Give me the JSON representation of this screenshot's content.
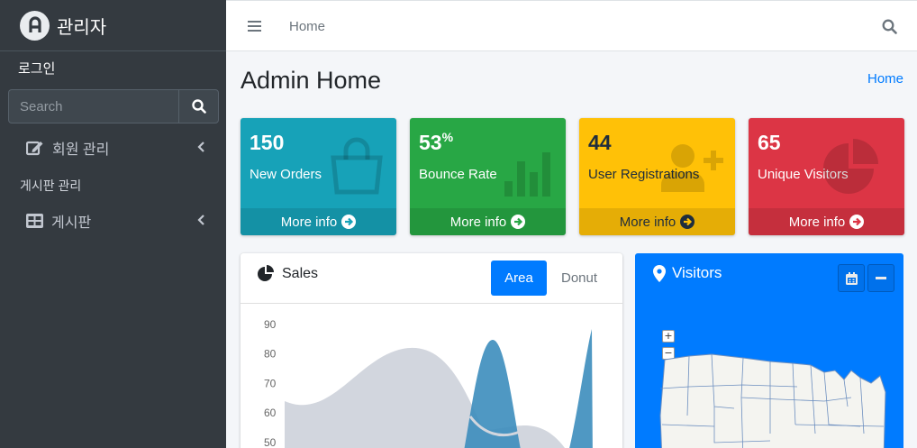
{
  "sidebar": {
    "brand_text": "관리자",
    "user_label": "로그인",
    "search": {
      "placeholder": "Search"
    },
    "items": [
      {
        "label": "회원 관리"
      },
      {
        "header": "게시판 관리"
      },
      {
        "label": "게시판"
      }
    ]
  },
  "navbar": {
    "home_link": "Home"
  },
  "content": {
    "title": "Admin Home",
    "breadcrumb": "Home"
  },
  "boxes": [
    {
      "value": "150",
      "suffix": "",
      "label": "New Orders",
      "footer": "More info",
      "color": "#17a2b8",
      "icon": "shopping-bag-icon"
    },
    {
      "value": "53",
      "suffix": "%",
      "label": "Bounce Rate",
      "footer": "More info",
      "color": "#28a745",
      "icon": "bar-chart-icon"
    },
    {
      "value": "44",
      "suffix": "",
      "label": "User Registrations",
      "footer": "More info",
      "color": "#ffc107",
      "icon": "user-plus-icon"
    },
    {
      "value": "65",
      "suffix": "",
      "label": "Unique Visitors",
      "footer": "More info",
      "color": "#dc3545",
      "icon": "pie-chart-icon"
    }
  ],
  "sales": {
    "title": "Sales",
    "tabs": [
      {
        "label": "Area",
        "active": true
      },
      {
        "label": "Donut",
        "active": false
      }
    ]
  },
  "visitors": {
    "title": "Visitors"
  },
  "chart_data": {
    "type": "area",
    "yticks": [
      "90",
      "80",
      "70",
      "60",
      "50"
    ],
    "ylim": [
      50,
      90
    ]
  }
}
